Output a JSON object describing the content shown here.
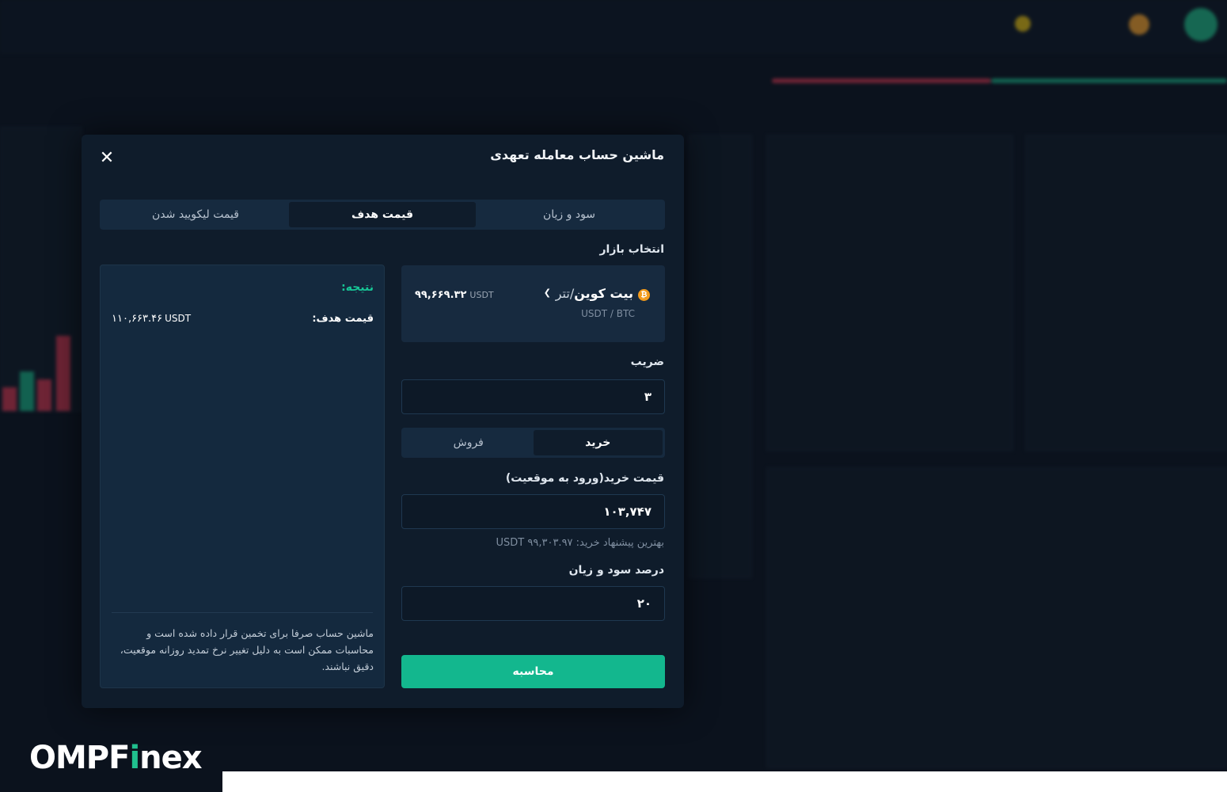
{
  "modal": {
    "title": "ماشین حساب معامله تعهدی",
    "tabs": [
      "سود و زیان",
      "قیمت هدف",
      "قیمت لیکویید شدن"
    ],
    "active_tab": 1,
    "market_label": "انتخاب بازار",
    "market": {
      "name": "بیت کوین",
      "quote": "/تتر",
      "pair": "USDT / BTC",
      "price": "۹۹,۶۶۹.۳۲",
      "price_unit": "USDT"
    },
    "leverage_label": "ضریب",
    "leverage_value": "۳",
    "side": {
      "buy": "خرید",
      "sell": "فروش",
      "active": "buy"
    },
    "entry_label": "قیمت خرید(ورود به موقعیت)",
    "entry_value": "۱۰۳,۷۴۷",
    "best_offer_hint": "بهترین پیشنهاد خرید: ۹۹,۳۰۳.۹۷ USDT",
    "pnl_label": "درصد سود و زیان",
    "pnl_value": "۲۰",
    "calculate_label": "محاسبه",
    "result": {
      "title": "نتیجه:",
      "target_label": "قیمت هدف:",
      "target_value": "۱۱۰,۶۶۳.۴۶",
      "target_unit": "USDT",
      "disclaimer": "ماشین حساب صرفا برای تخمین قرار داده شده است و محاسبات ممکن است به دلیل تغییر نرخ تمدید روزانه موقعیت، دقیق نباشند."
    }
  },
  "brand": {
    "before": "OMPF",
    "accent": "i",
    "after": "nex"
  },
  "colors": {
    "accent": "#13b78e",
    "result_title": "#17c495",
    "background": "#0b121d"
  }
}
